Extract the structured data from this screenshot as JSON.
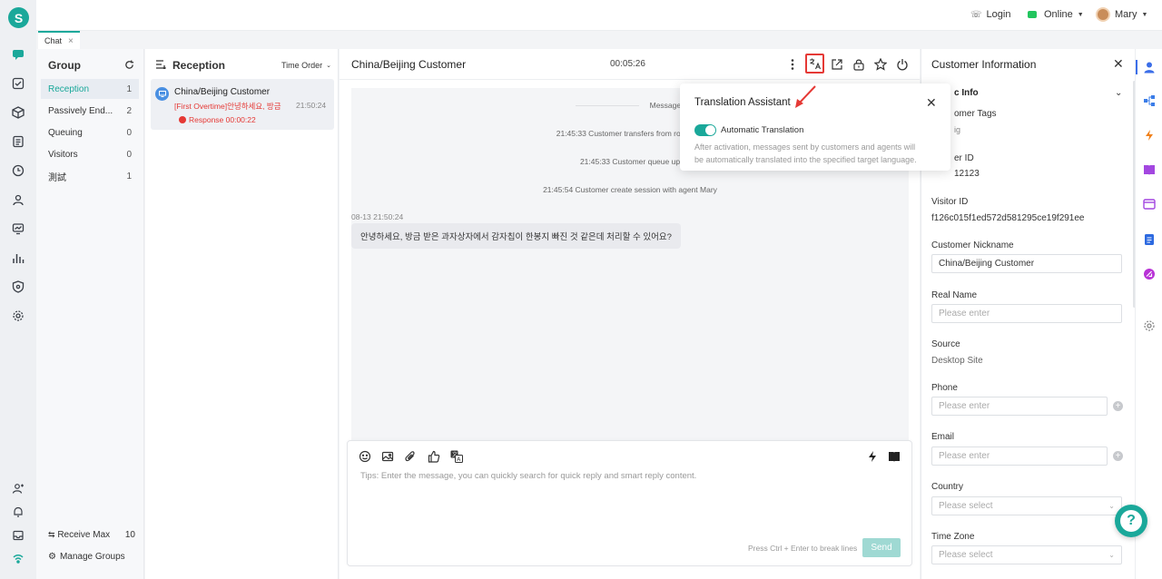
{
  "app": {
    "logo_letter": "S",
    "accent": "#1aa89a"
  },
  "topbar": {
    "login_label": "Login",
    "status_label": "Online",
    "user_name": "Mary"
  },
  "tabs": [
    {
      "label": "Chat",
      "close": "×"
    }
  ],
  "group": {
    "title": "Group",
    "items": [
      {
        "label": "Reception",
        "count": "1"
      },
      {
        "label": "Passively End...",
        "count": "2"
      },
      {
        "label": "Queuing",
        "count": "0"
      },
      {
        "label": "Visitors",
        "count": "0"
      },
      {
        "label": "測試",
        "count": "1"
      }
    ],
    "receive_max_label": "Receive Max",
    "receive_max_value": "10",
    "manage_groups_label": "Manage Groups"
  },
  "reception": {
    "title": "Reception",
    "sort_label": "Time Order",
    "conversation": {
      "name": "China/Beijing Customer",
      "preview": "[First Overtime]안녕하세요, 방금 ...",
      "time": "21:50:24",
      "response": "Response 00:00:22"
    }
  },
  "chat": {
    "title": "China/Beijing Customer",
    "timer": "00:05:26",
    "messages_divider": "Messages",
    "system_messages": [
      "21:45:33 Customer transfers from robot to l",
      "21:45:33 Customer queue up",
      "21:45:54 Customer create session with agent Mary"
    ],
    "message_timestamp": "08-13 21:50:24",
    "message_text": "안녕하세요, 방금 받은 과자상자에서 감자칩이 한봉지 빠진 것 같은데 처리할 수 있어요?",
    "composer_placeholder": "Tips: Enter the message, you can quickly search for quick reply and smart reply content.",
    "break_hint": "Press Ctrl + Enter to break lines",
    "send_label": "Send"
  },
  "translation_popup": {
    "title": "Translation Assistant",
    "toggle_label": "Automatic Translation",
    "toggle_on": true,
    "description_line1": "After activation, messages sent by customers and agents will",
    "description_line2": "be automatically translated into the specified target language."
  },
  "customer_info": {
    "title": "Customer Information",
    "section_title": "c Info",
    "tags_label": "omer Tags",
    "tags_value": "ig",
    "user_id_label": "er ID",
    "user_id_value": "12123",
    "visitor_id_label": "Visitor ID",
    "visitor_id_value": "f126c015f1ed572d581295ce19f291ee",
    "nickname_label": "Customer Nickname",
    "nickname_value": "China/Beijing Customer",
    "real_name_label": "Real Name",
    "real_name_placeholder": "Please enter",
    "source_label": "Source",
    "source_value": "Desktop Site",
    "phone_label": "Phone",
    "phone_placeholder": "Please enter",
    "email_label": "Email",
    "email_placeholder": "Please enter",
    "country_label": "Country",
    "country_placeholder": "Please select",
    "timezone_label": "Time Zone",
    "timezone_placeholder": "Please select"
  },
  "colors": {
    "accent": "#1aa89a",
    "danger": "#e53935",
    "highlight_box": "#e53935"
  }
}
